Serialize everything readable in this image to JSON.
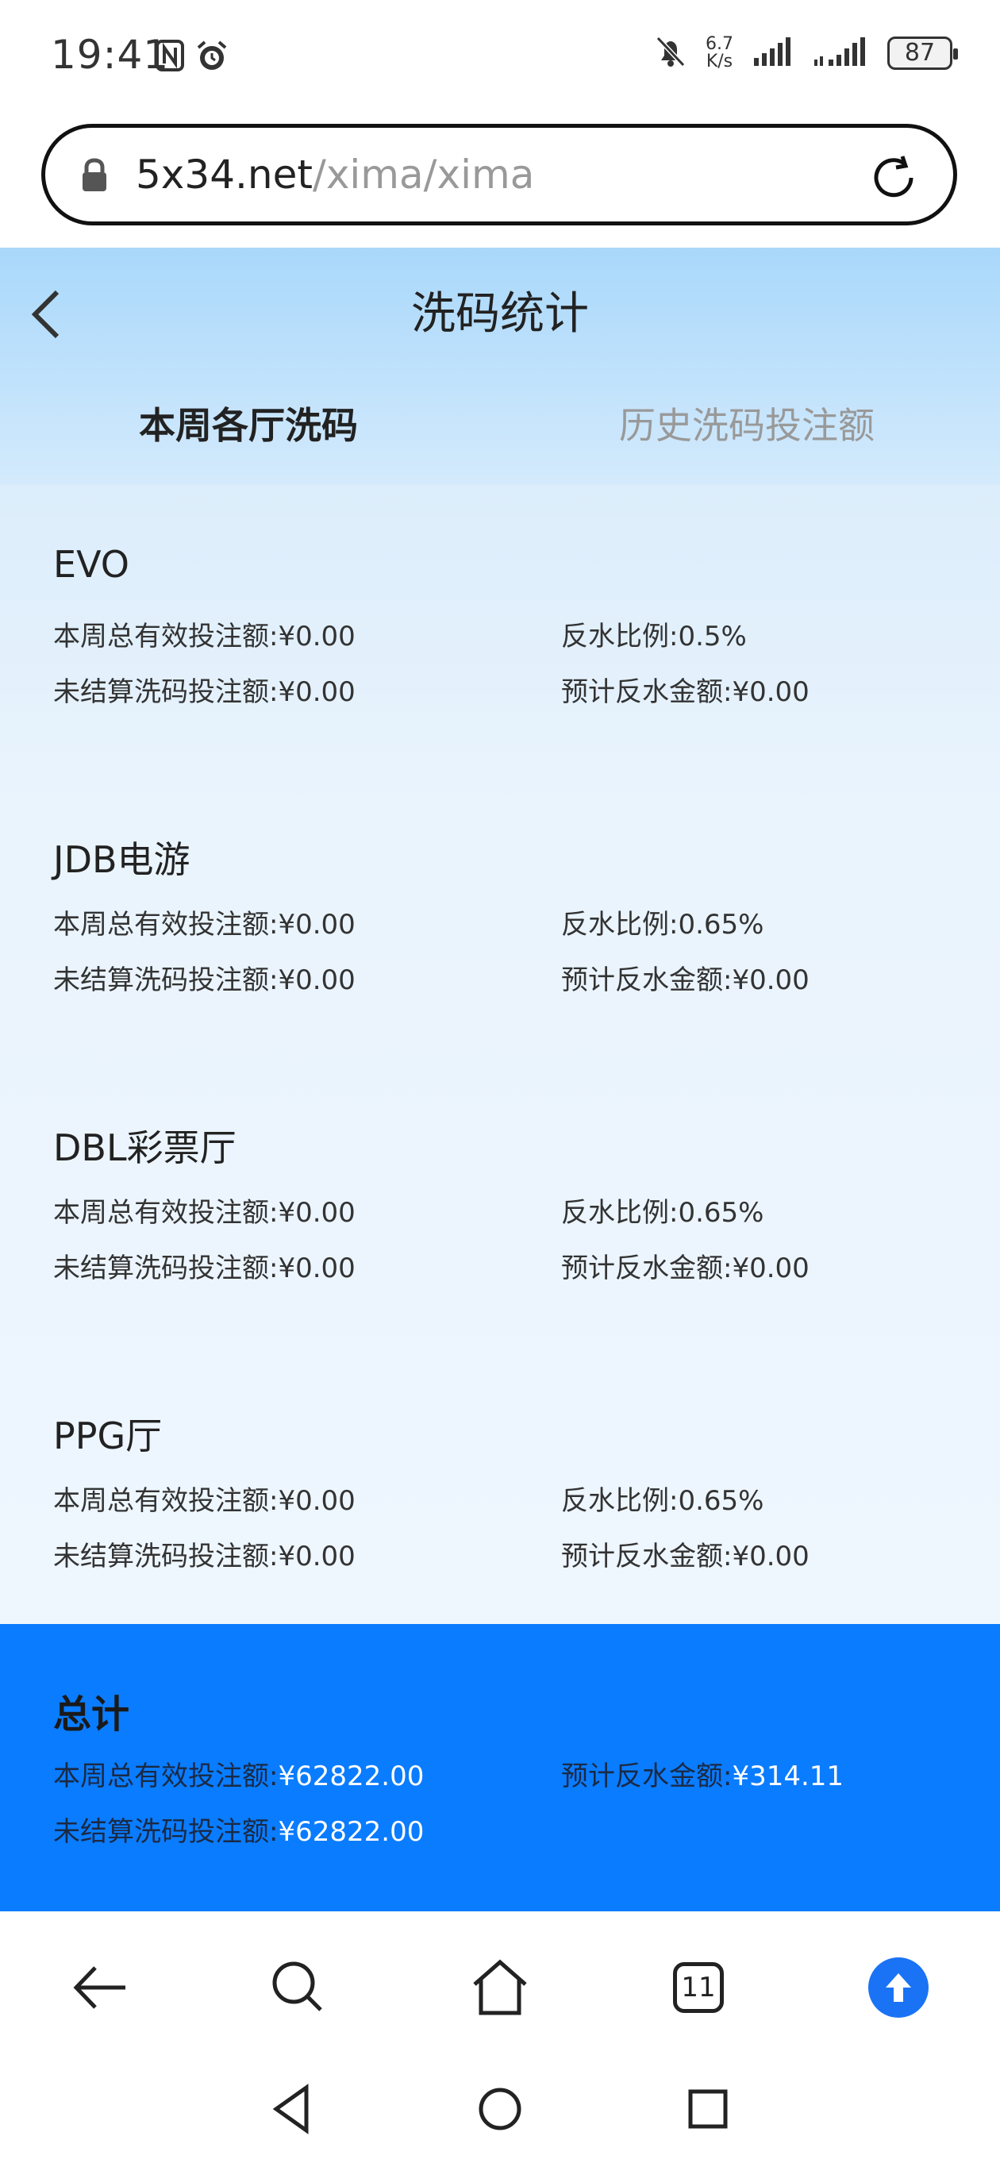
{
  "status_bar": {
    "time": "19:41",
    "net_speed_value": "6.7",
    "net_speed_unit": "K/s",
    "battery": "87"
  },
  "browser": {
    "url_domain": "5x34.net",
    "url_path": "/xima/xima",
    "tabs_count": "11"
  },
  "page": {
    "title": "洗码统计",
    "tabs": [
      {
        "label": "本周各厅洗码",
        "active": true
      },
      {
        "label": "历史洗码投注额",
        "active": false
      }
    ]
  },
  "labels": {
    "week_total_valid_bet": "本周总有效投注额:",
    "rebate_ratio": "反水比例:",
    "unsettled_bet": "未结算洗码投注额:",
    "estimated_rebate": "预计反水金额:"
  },
  "halls": [
    {
      "name": "EVO",
      "week_total": "¥0.00",
      "ratio": "0.5%",
      "unsettled": "¥0.00",
      "estimated": "¥0.00"
    },
    {
      "name": "JDB电游",
      "week_total": "¥0.00",
      "ratio": "0.65%",
      "unsettled": "¥0.00",
      "estimated": "¥0.00"
    },
    {
      "name": "DBL彩票厅",
      "week_total": "¥0.00",
      "ratio": "0.65%",
      "unsettled": "¥0.00",
      "estimated": "¥0.00"
    },
    {
      "name": "PPG厅",
      "week_total": "¥0.00",
      "ratio": "0.65%",
      "unsettled": "¥0.00",
      "estimated": "¥0.00"
    }
  ],
  "total": {
    "title": "总计",
    "week_total": "¥62822.00",
    "estimated": "¥314.11",
    "unsettled": "¥62822.00"
  },
  "colors": {
    "accent_blue": "#0a7cff",
    "header_gradient_top": "#a9d8fb",
    "upload_blue": "#1a73f5"
  }
}
